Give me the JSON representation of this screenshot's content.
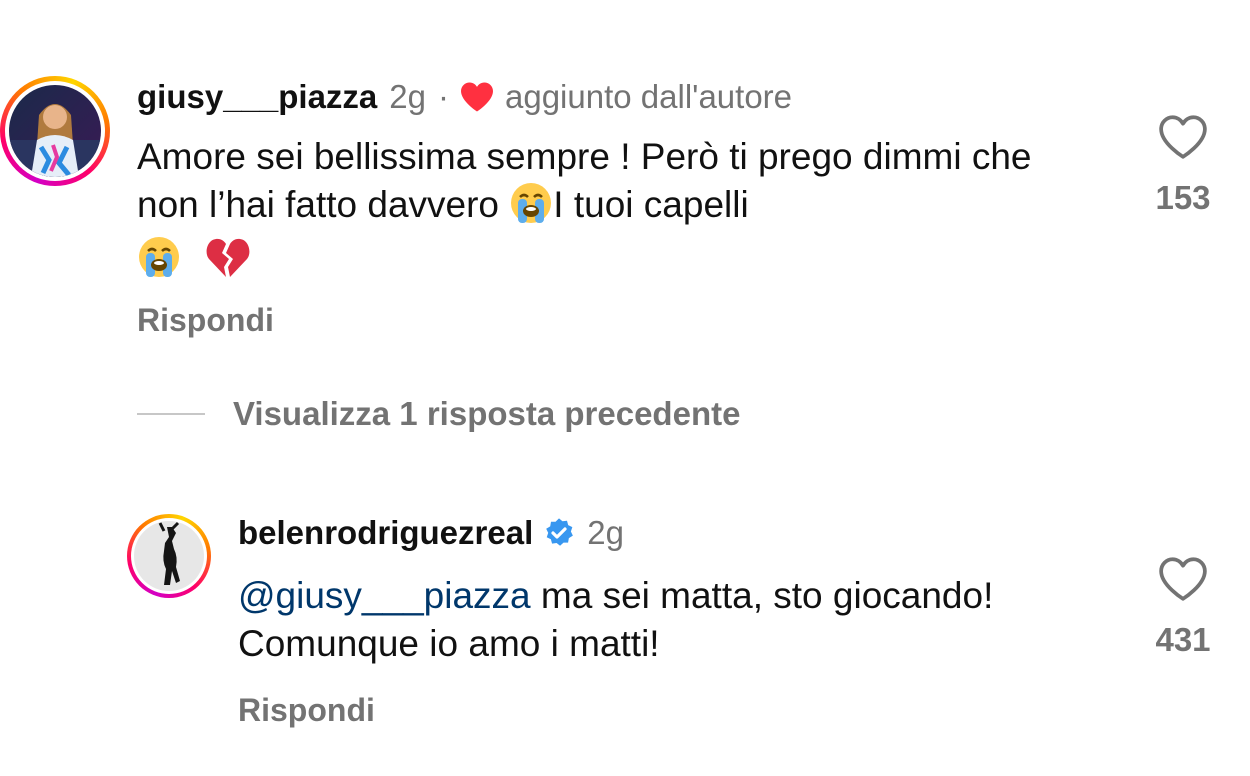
{
  "comments": [
    {
      "username": "giusy___piazza",
      "time": "2g",
      "separator": "·",
      "liked_by_author_label": "aggiunto dall'autore",
      "text_part1": "Amore sei bellissima sempre ! Però ti prego dimmi che non l’hai fatto davvero ",
      "text_part2": "I tuoi capelli ",
      "likes": "153",
      "reply_label": "Rispondi"
    },
    {
      "username": "belenrodriguezreal",
      "verified": true,
      "time": "2g",
      "mention": "@giusy___piazza",
      "text": " ma sei matta, sto giocando! Comunque io amo i matti!",
      "likes": "431",
      "reply_label": "Rispondi"
    }
  ],
  "view_replies_label": "Visualizza 1 risposta precedente",
  "colors": {
    "text": "#111111",
    "secondary": "#737373",
    "heart_red": "#ff3040",
    "verified_blue": "#3897f0",
    "mention": "#00376b"
  },
  "icons": [
    "heart-icon",
    "verified-badge-icon",
    "loudly-crying-face-emoji",
    "broken-heart-emoji",
    "like-outline-icon"
  ]
}
